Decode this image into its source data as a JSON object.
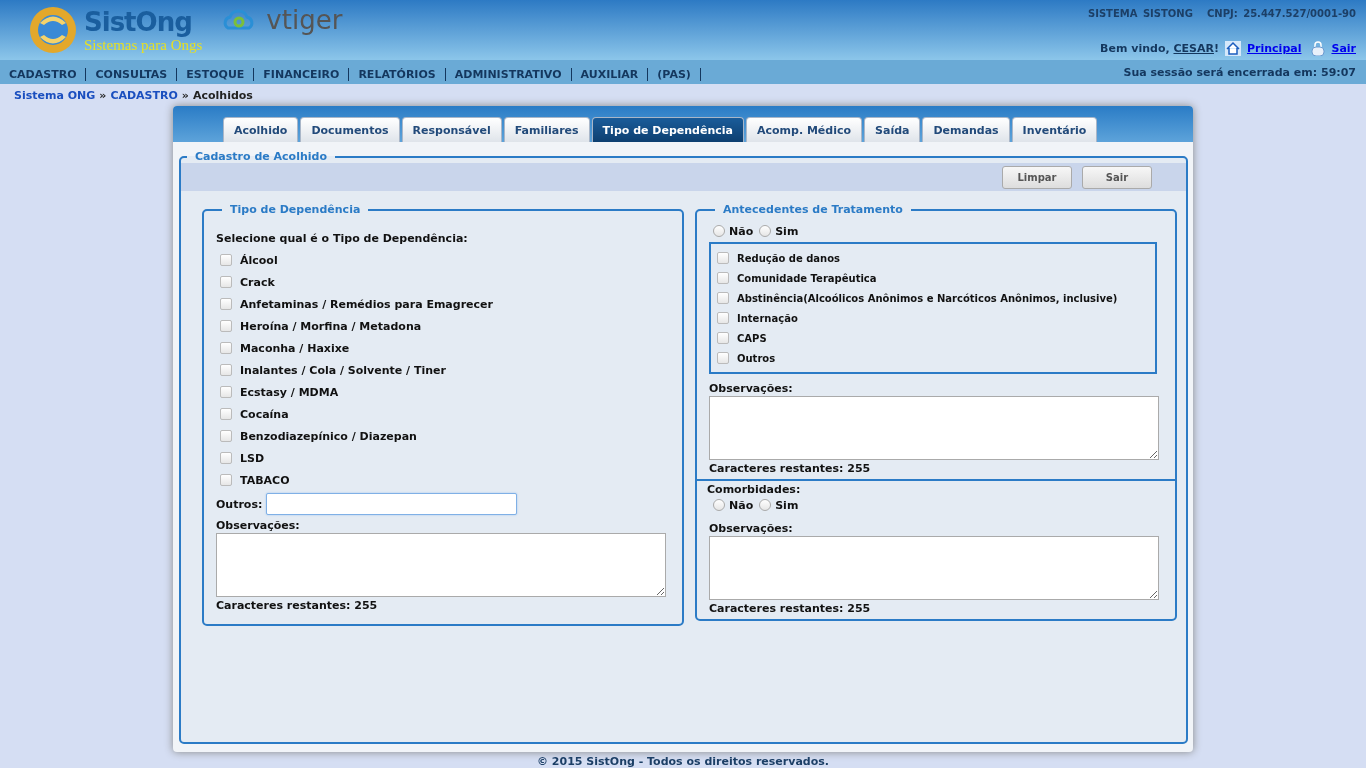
{
  "header": {
    "logo_title": "SistOng",
    "logo_subtitle": "Sistemas para Ongs",
    "partner_logo": "vtiger",
    "system_name": "SISTEMA SISTONG",
    "cnpj": "CNPJ: 25.447.527/0001-90",
    "welcome": "Bem vindo, ",
    "user": "CESAR",
    "welcome_end": "!",
    "links": [
      "Principal",
      "Sair"
    ]
  },
  "menu": {
    "items": [
      "CADASTRO",
      "CONSULTAS",
      "ESTOQUE",
      "FINANCEIRO",
      "RELATÓRIOS",
      "ADMINISTRATIVO",
      "AUXILIAR",
      "(PAS)"
    ],
    "session": "Sua sessão será encerrada em: 59:07"
  },
  "breadcrumb": {
    "items": [
      {
        "label": "Sistema ONG",
        "link": true
      },
      {
        "label": "CADASTRO",
        "link": true
      },
      {
        "label": "Acolhidos",
        "link": false
      }
    ],
    "separator": "»"
  },
  "tabs": [
    {
      "label": "Acolhido",
      "selected": false
    },
    {
      "label": "Documentos",
      "selected": false
    },
    {
      "label": "Responsável",
      "selected": false
    },
    {
      "label": "Familiares",
      "selected": false
    },
    {
      "label": "Tipo de Dependência",
      "selected": true
    },
    {
      "label": "Acomp. Médico",
      "selected": false
    },
    {
      "label": "Saída",
      "selected": false
    },
    {
      "label": "Demandas",
      "selected": false
    },
    {
      "label": "Inventário",
      "selected": false
    }
  ],
  "form": {
    "legend": "Cadastro de Acolhido",
    "buttons": [
      "Limpar",
      "Sair"
    ]
  },
  "dependency": {
    "legend": "Tipo de Dependência",
    "prompt": "Selecione qual é o Tipo de Dependência:",
    "options": [
      {
        "label": "Álcool",
        "checked": false
      },
      {
        "label": "Crack",
        "checked": false
      },
      {
        "label": "Anfetaminas / Remédios para Emagrecer",
        "checked": false
      },
      {
        "label": "Heroína / Morfina / Metadona",
        "checked": false
      },
      {
        "label": "Maconha / Haxixe",
        "checked": false
      },
      {
        "label": "Inalantes / Cola / Solvente / Tiner",
        "checked": false
      },
      {
        "label": "Ecstasy / MDMA",
        "checked": false
      },
      {
        "label": "Cocaína",
        "checked": false
      },
      {
        "label": "Benzodiazepínico / Diazepan",
        "checked": false
      },
      {
        "label": "LSD",
        "checked": false
      },
      {
        "label": "TABACO",
        "checked": false
      }
    ],
    "other_label": "Outros:",
    "notes_label": "Observações:",
    "counter": "Caracteres restantes: 255"
  },
  "treatment": {
    "legend": "Antecedentes de Tratamento",
    "radios": [
      {
        "label": "Não",
        "selected": false
      },
      {
        "label": "Sim",
        "selected": false
      }
    ],
    "options": [
      {
        "label": "Redução de danos",
        "checked": false
      },
      {
        "label": "Comunidade Terapêutica",
        "checked": false
      },
      {
        "label": "Abstinência(Alcoólicos Anônimos e Narcóticos Anônimos, inclusive)",
        "checked": false
      },
      {
        "label": "Internação",
        "checked": false
      },
      {
        "label": "CAPS",
        "checked": false
      },
      {
        "label": "Outros",
        "checked": false
      }
    ],
    "notes_label": "Observações:",
    "counter": "Caracteres restantes: 255"
  },
  "comorbidities": {
    "label": "Comorbidades:",
    "radios": [
      {
        "label": "Não",
        "selected": false
      },
      {
        "label": "Sim",
        "selected": false
      }
    ],
    "notes_label": "Observações:",
    "counter": "Caracteres restantes: 255"
  },
  "footer": "© 2015 SistOng - Todos os direitos reservados."
}
